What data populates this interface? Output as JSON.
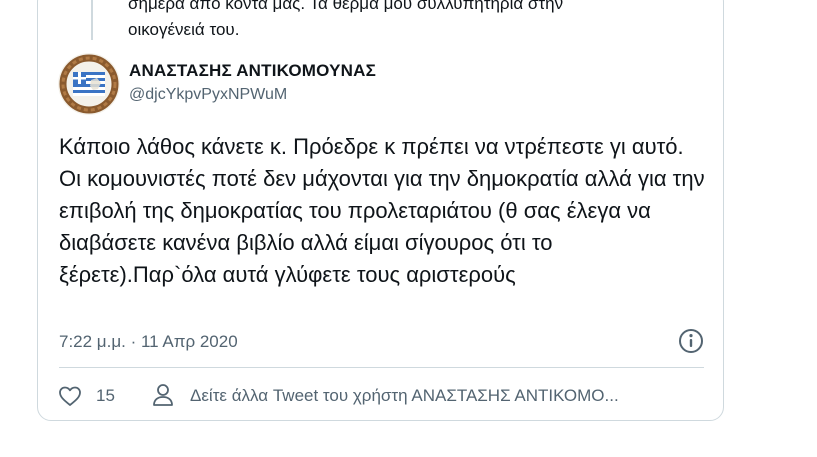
{
  "quoted": {
    "text": "σήμερα από κοντά μας. Τα θερμά μου συλλυπητήρια στην\nοικογένειά του."
  },
  "author": {
    "name": "ΑΝΑΣΤΑΣΗΣ ΑΝΤΙΚΟΜΟΥΝΑΣ",
    "handle": "@djcYkpvPyxNPWuM",
    "avatar_icon": "greek-flag-wreath-avatar"
  },
  "tweet": {
    "text": "Κάποιο λάθος κάνετε κ. Πρόεδρε κ πρέπει να ντρέπεστε γι αυτό. Οι κομουνιστές ποτέ δεν μάχονται για την δημοκρατία αλλά για την επιβολή της δημοκρατίας του προλεταριάτου (θ σας έλεγα να διαβάσετε κανένα βιβλίο αλλά είμαι σίγουρος ότι το ξέρετε).Παρ`όλα αυτά γλύφετε τους αριστερούς",
    "timestamp": "7:22 μ.μ. · 11 Απρ 2020"
  },
  "actions": {
    "like_icon": "heart-icon",
    "like_count": "15",
    "profile_icon": "person-icon",
    "more_tweets_label": "Δείτε άλλα Tweet του χρήστη ΑΝΑΣΤΑΣΗΣ ΑΝΤΙΚΟΜΟ...",
    "info_icon": "info-icon"
  },
  "colors": {
    "text_primary": "#0f1419",
    "text_secondary": "#536471",
    "border": "#cfd9de"
  }
}
